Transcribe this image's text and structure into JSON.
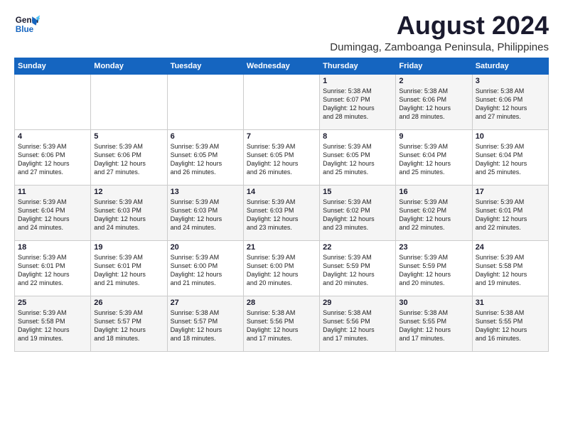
{
  "header": {
    "logo_line1": "General",
    "logo_line2": "Blue",
    "month_year": "August 2024",
    "location": "Dumingag, Zamboanga Peninsula, Philippines"
  },
  "weekdays": [
    "Sunday",
    "Monday",
    "Tuesday",
    "Wednesday",
    "Thursday",
    "Friday",
    "Saturday"
  ],
  "weeks": [
    [
      {
        "day": "",
        "info": ""
      },
      {
        "day": "",
        "info": ""
      },
      {
        "day": "",
        "info": ""
      },
      {
        "day": "",
        "info": ""
      },
      {
        "day": "1",
        "info": "Sunrise: 5:38 AM\nSunset: 6:07 PM\nDaylight: 12 hours\nand 28 minutes."
      },
      {
        "day": "2",
        "info": "Sunrise: 5:38 AM\nSunset: 6:06 PM\nDaylight: 12 hours\nand 28 minutes."
      },
      {
        "day": "3",
        "info": "Sunrise: 5:38 AM\nSunset: 6:06 PM\nDaylight: 12 hours\nand 27 minutes."
      }
    ],
    [
      {
        "day": "4",
        "info": "Sunrise: 5:39 AM\nSunset: 6:06 PM\nDaylight: 12 hours\nand 27 minutes."
      },
      {
        "day": "5",
        "info": "Sunrise: 5:39 AM\nSunset: 6:06 PM\nDaylight: 12 hours\nand 27 minutes."
      },
      {
        "day": "6",
        "info": "Sunrise: 5:39 AM\nSunset: 6:05 PM\nDaylight: 12 hours\nand 26 minutes."
      },
      {
        "day": "7",
        "info": "Sunrise: 5:39 AM\nSunset: 6:05 PM\nDaylight: 12 hours\nand 26 minutes."
      },
      {
        "day": "8",
        "info": "Sunrise: 5:39 AM\nSunset: 6:05 PM\nDaylight: 12 hours\nand 25 minutes."
      },
      {
        "day": "9",
        "info": "Sunrise: 5:39 AM\nSunset: 6:04 PM\nDaylight: 12 hours\nand 25 minutes."
      },
      {
        "day": "10",
        "info": "Sunrise: 5:39 AM\nSunset: 6:04 PM\nDaylight: 12 hours\nand 25 minutes."
      }
    ],
    [
      {
        "day": "11",
        "info": "Sunrise: 5:39 AM\nSunset: 6:04 PM\nDaylight: 12 hours\nand 24 minutes."
      },
      {
        "day": "12",
        "info": "Sunrise: 5:39 AM\nSunset: 6:03 PM\nDaylight: 12 hours\nand 24 minutes."
      },
      {
        "day": "13",
        "info": "Sunrise: 5:39 AM\nSunset: 6:03 PM\nDaylight: 12 hours\nand 24 minutes."
      },
      {
        "day": "14",
        "info": "Sunrise: 5:39 AM\nSunset: 6:03 PM\nDaylight: 12 hours\nand 23 minutes."
      },
      {
        "day": "15",
        "info": "Sunrise: 5:39 AM\nSunset: 6:02 PM\nDaylight: 12 hours\nand 23 minutes."
      },
      {
        "day": "16",
        "info": "Sunrise: 5:39 AM\nSunset: 6:02 PM\nDaylight: 12 hours\nand 22 minutes."
      },
      {
        "day": "17",
        "info": "Sunrise: 5:39 AM\nSunset: 6:01 PM\nDaylight: 12 hours\nand 22 minutes."
      }
    ],
    [
      {
        "day": "18",
        "info": "Sunrise: 5:39 AM\nSunset: 6:01 PM\nDaylight: 12 hours\nand 22 minutes."
      },
      {
        "day": "19",
        "info": "Sunrise: 5:39 AM\nSunset: 6:01 PM\nDaylight: 12 hours\nand 21 minutes."
      },
      {
        "day": "20",
        "info": "Sunrise: 5:39 AM\nSunset: 6:00 PM\nDaylight: 12 hours\nand 21 minutes."
      },
      {
        "day": "21",
        "info": "Sunrise: 5:39 AM\nSunset: 6:00 PM\nDaylight: 12 hours\nand 20 minutes."
      },
      {
        "day": "22",
        "info": "Sunrise: 5:39 AM\nSunset: 5:59 PM\nDaylight: 12 hours\nand 20 minutes."
      },
      {
        "day": "23",
        "info": "Sunrise: 5:39 AM\nSunset: 5:59 PM\nDaylight: 12 hours\nand 20 minutes."
      },
      {
        "day": "24",
        "info": "Sunrise: 5:39 AM\nSunset: 5:58 PM\nDaylight: 12 hours\nand 19 minutes."
      }
    ],
    [
      {
        "day": "25",
        "info": "Sunrise: 5:39 AM\nSunset: 5:58 PM\nDaylight: 12 hours\nand 19 minutes."
      },
      {
        "day": "26",
        "info": "Sunrise: 5:39 AM\nSunset: 5:57 PM\nDaylight: 12 hours\nand 18 minutes."
      },
      {
        "day": "27",
        "info": "Sunrise: 5:38 AM\nSunset: 5:57 PM\nDaylight: 12 hours\nand 18 minutes."
      },
      {
        "day": "28",
        "info": "Sunrise: 5:38 AM\nSunset: 5:56 PM\nDaylight: 12 hours\nand 17 minutes."
      },
      {
        "day": "29",
        "info": "Sunrise: 5:38 AM\nSunset: 5:56 PM\nDaylight: 12 hours\nand 17 minutes."
      },
      {
        "day": "30",
        "info": "Sunrise: 5:38 AM\nSunset: 5:55 PM\nDaylight: 12 hours\nand 17 minutes."
      },
      {
        "day": "31",
        "info": "Sunrise: 5:38 AM\nSunset: 5:55 PM\nDaylight: 12 hours\nand 16 minutes."
      }
    ]
  ]
}
